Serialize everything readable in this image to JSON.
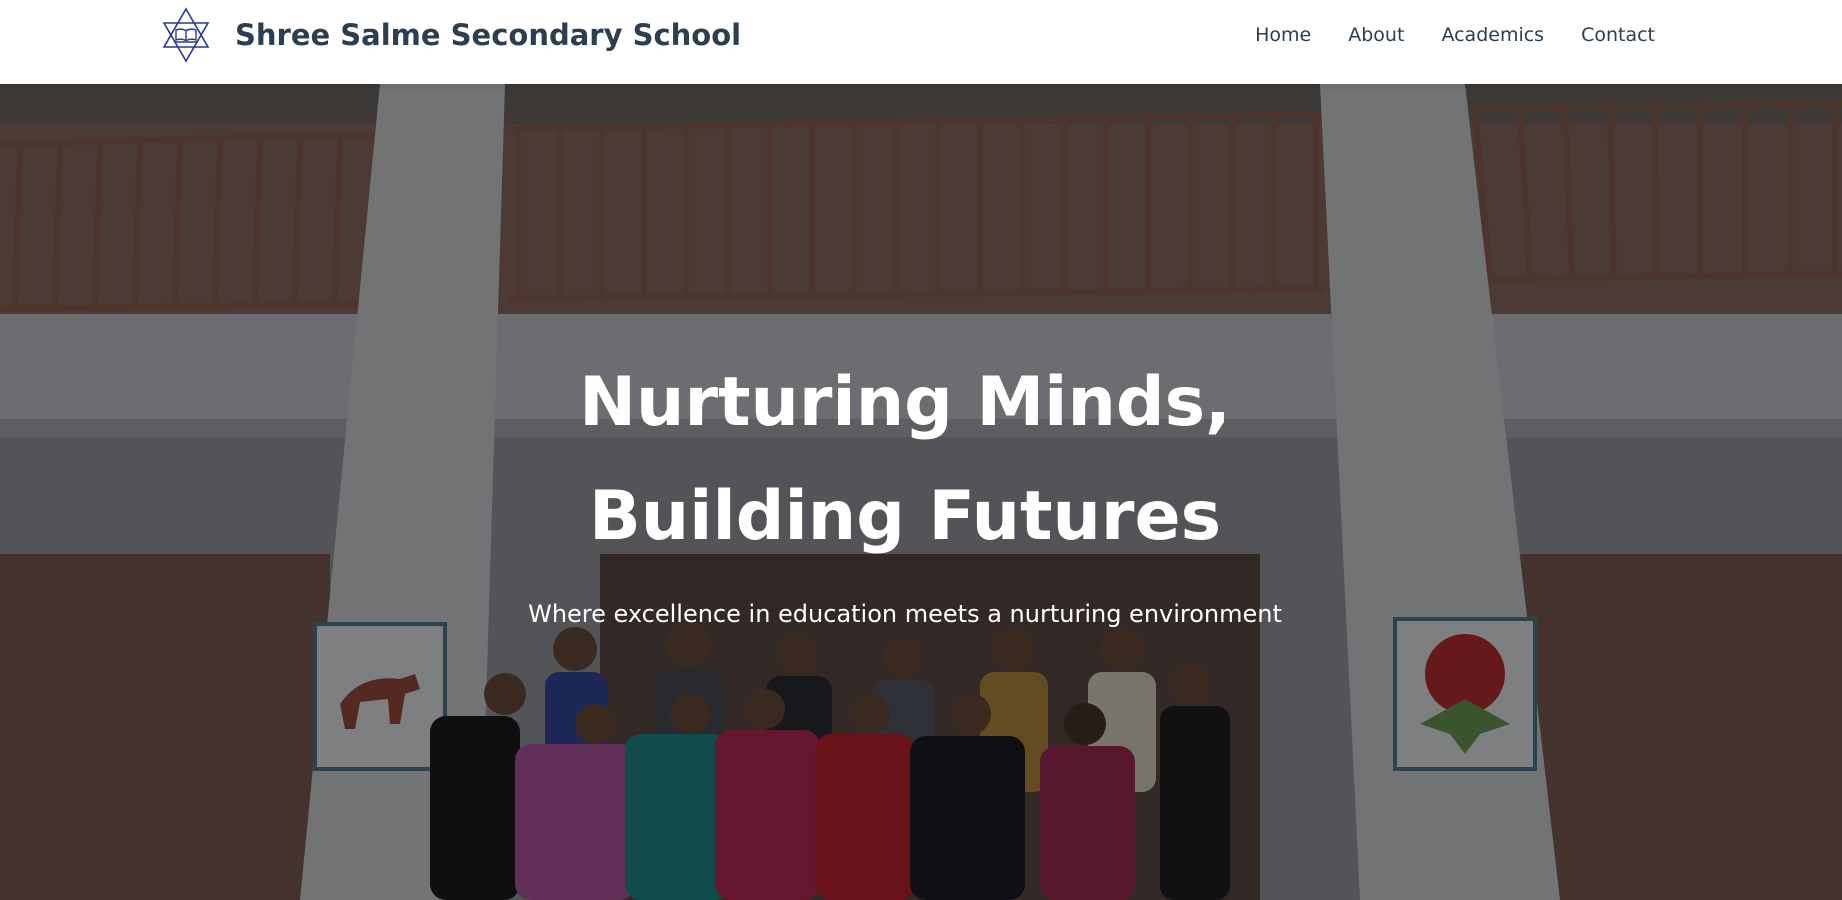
{
  "header": {
    "logo_icon": "star-of-david-book-icon",
    "school_name": "Shree Salme Secondary School",
    "nav": [
      {
        "label": "Home"
      },
      {
        "label": "About"
      },
      {
        "label": "Academics"
      },
      {
        "label": "Contact"
      }
    ]
  },
  "hero": {
    "title": "Nurturing Minds, Building Futures",
    "subtitle": "Where excellence in education meets a nurturing environment",
    "background_image": "school-building-group-photo"
  },
  "colors": {
    "brand_text": "#2c3e50",
    "logo": "#2b3a8f",
    "hero_text": "#ffffff",
    "overlay": "rgba(0,0,0,0.45)"
  }
}
